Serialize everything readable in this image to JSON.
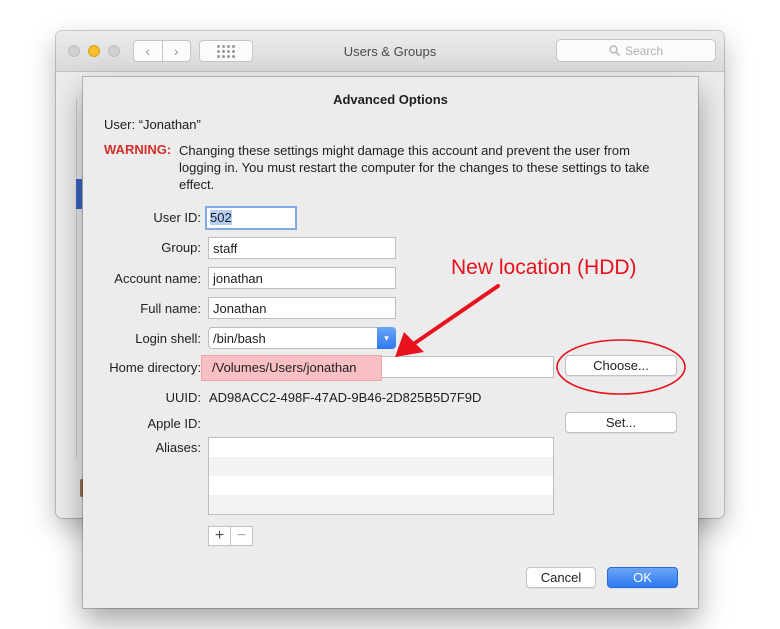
{
  "window": {
    "title": "Users & Groups",
    "search_placeholder": "Search",
    "nav_back_glyph": "‹",
    "nav_forward_glyph": "›"
  },
  "sheet": {
    "title": "Advanced Options",
    "user_label": "User:",
    "user_name": "“Jonathan”",
    "warning_label": "WARNING:",
    "warning_text": "Changing these settings might damage this account and prevent the user from logging in. You must restart the computer for the changes to these settings to take effect.",
    "fields": {
      "user_id": {
        "label": "User ID:",
        "value": "502"
      },
      "group": {
        "label": "Group:",
        "value": "staff"
      },
      "account_name": {
        "label": "Account name:",
        "value": "jonathan"
      },
      "full_name": {
        "label": "Full name:",
        "value": "Jonathan"
      },
      "login_shell": {
        "label": "Login shell:",
        "value": "/bin/bash"
      },
      "home_directory": {
        "label": "Home directory:",
        "value": "/Volumes/Users/jonathan"
      },
      "uuid": {
        "label": "UUID:",
        "value": "AD98ACC2-498F-47AD-9B46-2D825B5D7F9D"
      },
      "apple_id": {
        "label": "Apple ID:",
        "value": ""
      },
      "aliases": {
        "label": "Aliases:"
      }
    },
    "buttons": {
      "choose": "Choose...",
      "set": "Set...",
      "add": "+",
      "remove": "−",
      "cancel": "Cancel",
      "ok": "OK"
    }
  },
  "annotation": {
    "text": "New location (HDD)",
    "color": "#e8121e"
  },
  "colors": {
    "accent": "#2d79f0",
    "warning": "#d3302b",
    "highlight": "#f8c0c4"
  }
}
